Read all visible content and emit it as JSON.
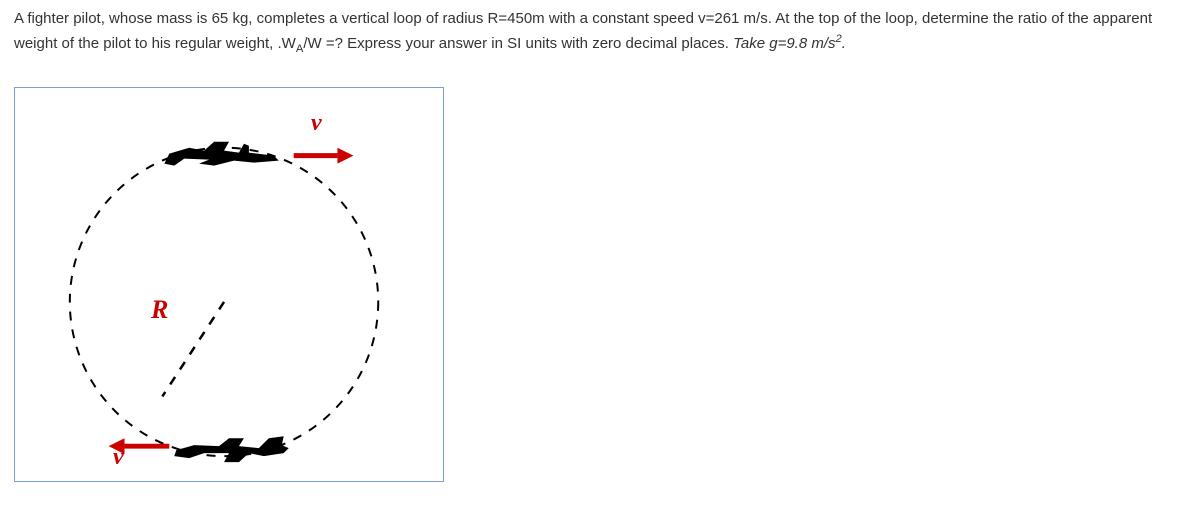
{
  "question": {
    "part1": "A fighter pilot, whose mass is 65 kg,  completes a vertical loop of radius R=450m with a constant speed v=261 m/s. At the top of the loop, determine the ratio of the apparent weight of the pilot to his regular weight, .W",
    "sub1": "A",
    "part2": "/W =? Express your answer in SI units with zero decimal places. ",
    "italic1": "Take g=9.8 m/s",
    "sup1": "2",
    "part3": "."
  },
  "labels": {
    "v": "v",
    "R": "R"
  }
}
